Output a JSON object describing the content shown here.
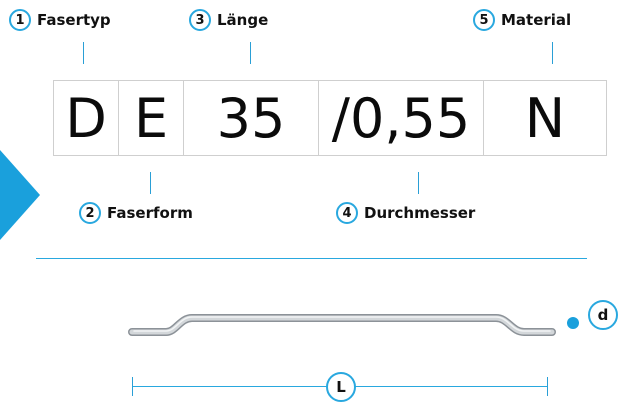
{
  "callouts": [
    {
      "number": "1",
      "label": "Fasertyp"
    },
    {
      "number": "2",
      "label": "Faserform"
    },
    {
      "number": "3",
      "label": "Länge"
    },
    {
      "number": "4",
      "label": "Durchmesser"
    },
    {
      "number": "5",
      "label": "Material"
    }
  ],
  "code": [
    "D",
    "E",
    "35",
    "/0,55",
    "N"
  ],
  "dimensions": {
    "diameter": "d",
    "length": "L"
  },
  "colors": {
    "accent": "#29a8df",
    "fiber": "#b8bdc2",
    "text": "#111111"
  }
}
